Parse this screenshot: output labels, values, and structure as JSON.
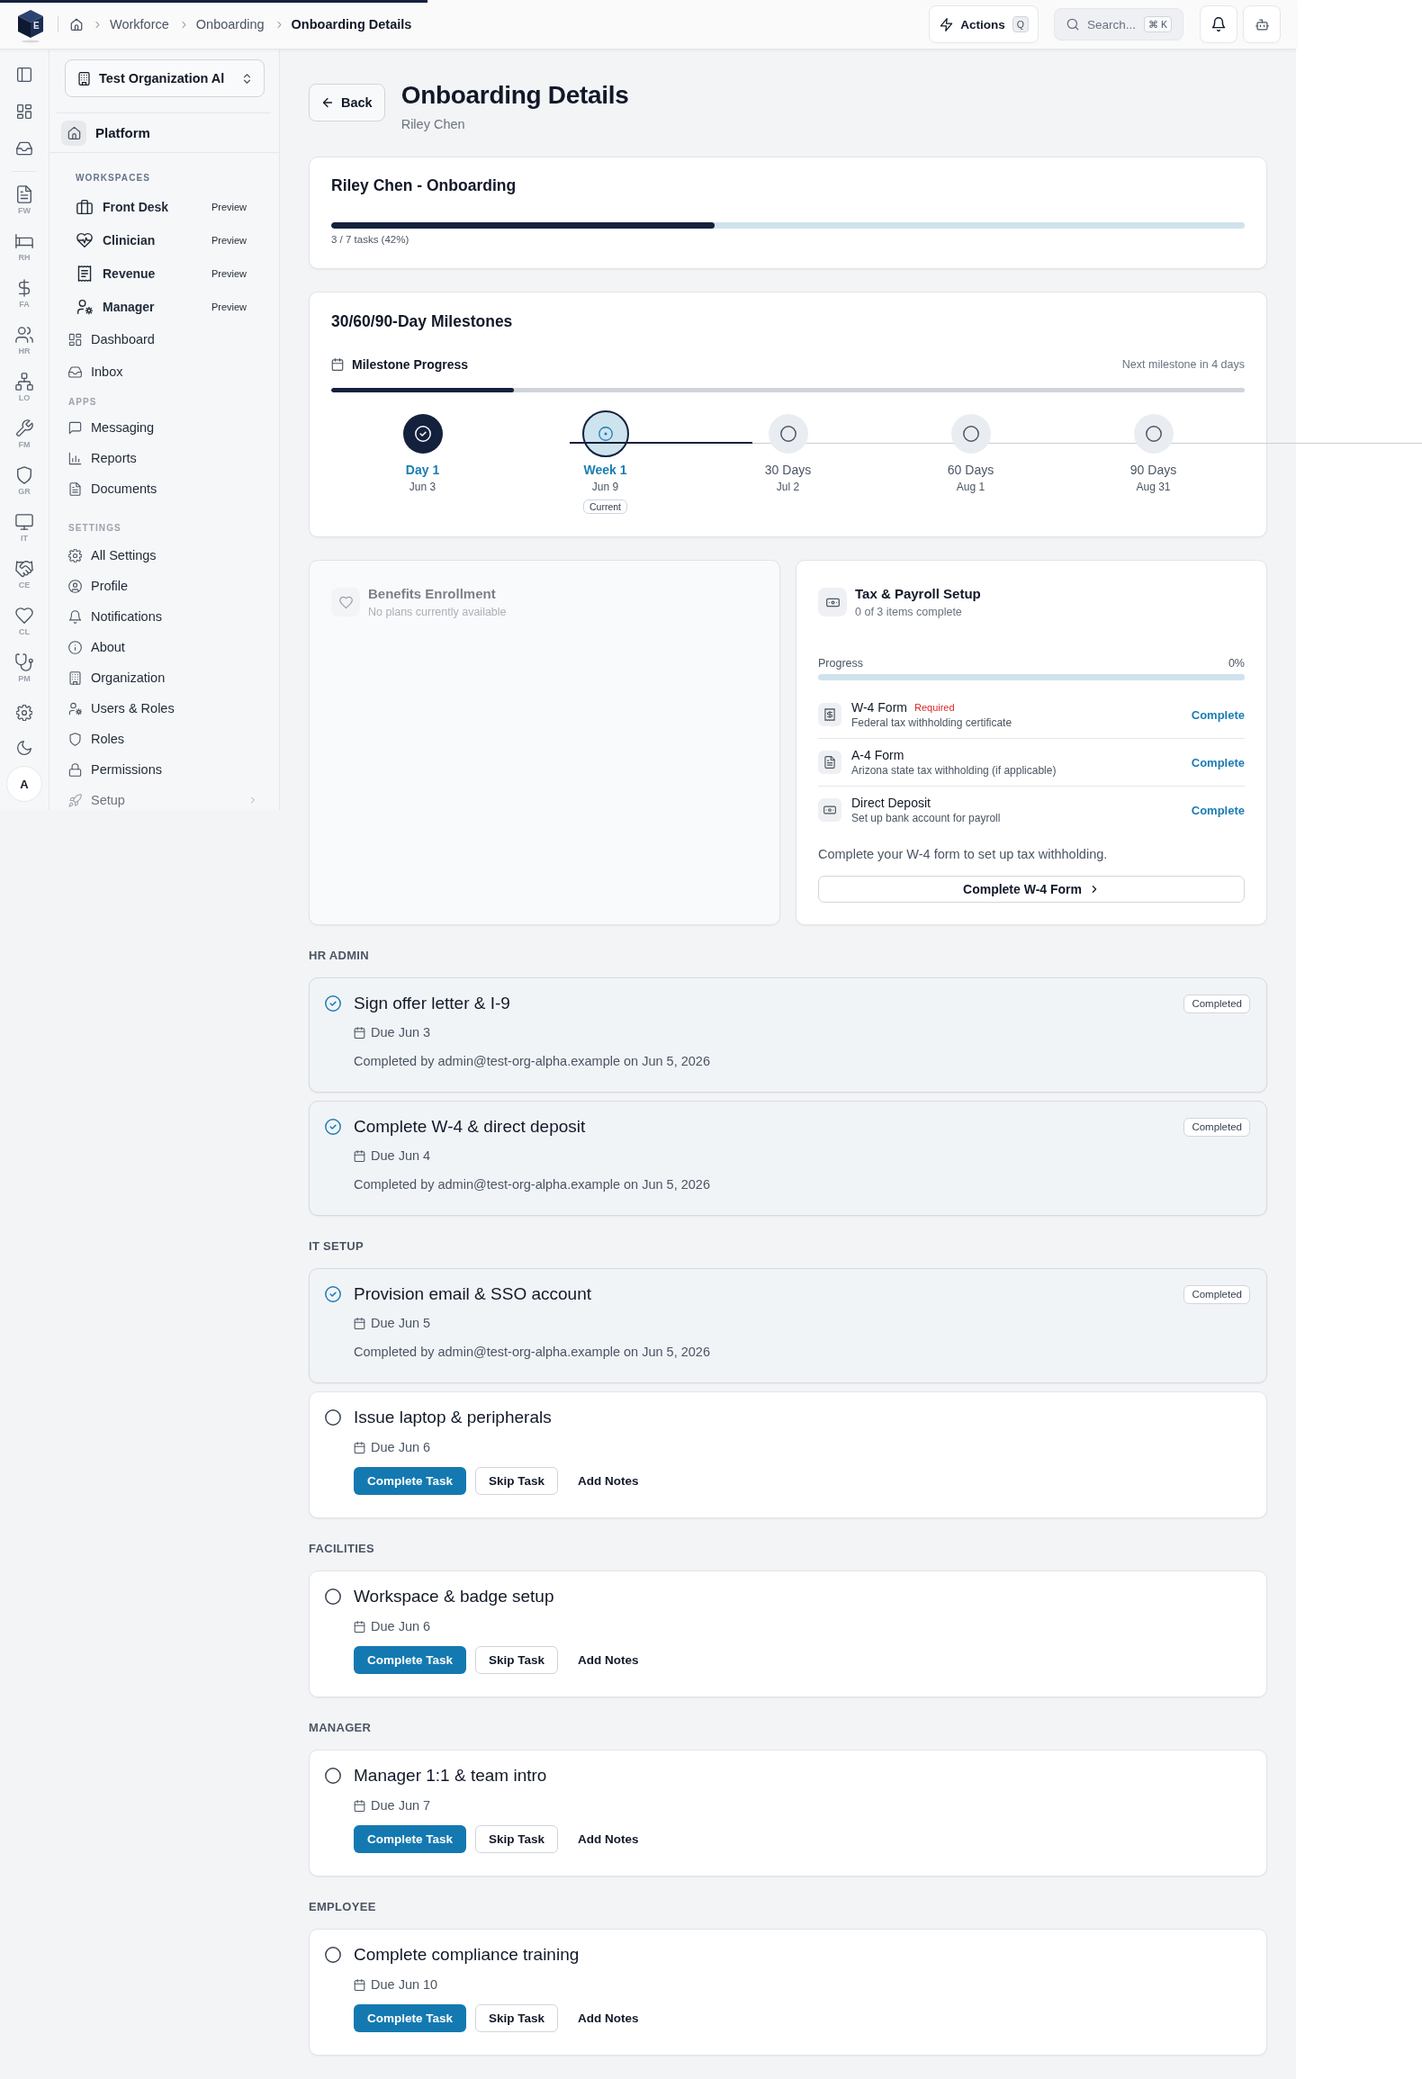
{
  "top_bar": {
    "loading_bar": {
      "level": 0.33
    },
    "logo": {
      "letter": "E"
    },
    "breadcrumbs": [
      {
        "label": "Workforce",
        "current": false
      },
      {
        "label": "Onboarding",
        "current": false
      },
      {
        "label": "Onboarding Details",
        "current": true
      }
    ],
    "actions_button": {
      "label": "Actions",
      "shortcut": "Q"
    },
    "search_button": {
      "label": "Search...",
      "shortcut": "⌘ K"
    }
  },
  "rail": {
    "items": [
      {
        "label": "FW"
      },
      {
        "label": "RH"
      },
      {
        "label": "FA"
      },
      {
        "label": "HR"
      },
      {
        "label": "LO"
      },
      {
        "label": "FM"
      },
      {
        "label": "GR"
      },
      {
        "label": "IT"
      },
      {
        "label": "CE"
      },
      {
        "label": "CL"
      },
      {
        "label": "PM"
      }
    ],
    "avatar": {
      "initial": "A"
    }
  },
  "sidebar": {
    "org_selector": {
      "value": "Test Organization Al"
    },
    "platform": {
      "label": "Platform"
    },
    "sections": [
      {
        "kind": "workspaces",
        "heading": "WORKSPACES",
        "items": [
          {
            "label": "Front Desk",
            "badge": "Preview"
          },
          {
            "label": "Clinician",
            "badge": "Preview"
          },
          {
            "label": "Revenue",
            "badge": "Preview"
          },
          {
            "label": "Manager",
            "badge": "Preview"
          }
        ]
      },
      {
        "kind": "nav",
        "items": [
          {
            "label": "Dashboard"
          },
          {
            "label": "Inbox"
          }
        ]
      },
      {
        "kind": "nav",
        "heading": "APPS",
        "items": [
          {
            "label": "Messaging"
          },
          {
            "label": "Reports"
          },
          {
            "label": "Documents"
          }
        ]
      },
      {
        "kind": "nav",
        "heading": "SETTINGS",
        "items": [
          {
            "label": "All Settings",
            "expandable": false
          },
          {
            "label": "Profile",
            "expandable": false
          },
          {
            "label": "Notifications",
            "expandable": false
          },
          {
            "label": "About",
            "expandable": false
          },
          {
            "label": "Organization",
            "expandable": false
          },
          {
            "label": "Users & Roles",
            "expandable": false
          },
          {
            "label": "Roles",
            "expandable": false
          },
          {
            "label": "Permissions",
            "expandable": false
          },
          {
            "label": "Setup",
            "expandable": true
          }
        ]
      }
    ]
  },
  "header": {
    "back_button": "Back",
    "title": "Onboarding Details",
    "subtitle": "Riley Chen"
  },
  "progress_card": {
    "title": "Riley Chen - Onboarding",
    "level": 0.42,
    "caption": "3 / 7 tasks (42%)"
  },
  "milestones_card": {
    "title": "30/60/90-Day Milestones",
    "progress_label": "Milestone Progress",
    "next_note": "Next milestone in 4 days",
    "level": 0.2,
    "milestones": [
      {
        "label": "Day 1",
        "date": "Jun 3",
        "completed": true,
        "current": false
      },
      {
        "label": "Week 1",
        "date": "Jun 9",
        "completed": false,
        "current": true,
        "badge": "Current"
      },
      {
        "label": "30 Days",
        "date": "Jul 2",
        "completed": false,
        "current": false
      },
      {
        "label": "60 Days",
        "date": "Aug 1",
        "completed": false,
        "current": false
      },
      {
        "label": "90 Days",
        "date": "Aug 31",
        "completed": false,
        "current": false
      }
    ]
  },
  "benefits_card": {
    "title": "Benefits Enrollment",
    "subtitle": "No plans currently available",
    "disabled": true
  },
  "tax_card": {
    "title": "Tax & Payroll Setup",
    "subtitle": "0 of 3 items complete",
    "progress_label": "Progress",
    "progress_value": "0%",
    "level": 0,
    "items": [
      {
        "title": "W-4 Form",
        "tag": "Required",
        "subtitle": "Federal tax withholding certificate",
        "action": "Complete"
      },
      {
        "title": "A-4 Form",
        "subtitle": "Arizona state tax withholding (if applicable)",
        "action": "Complete"
      },
      {
        "title": "Direct Deposit",
        "subtitle": "Set up bank account for payroll",
        "action": "Complete"
      }
    ],
    "hint": "Complete your W-4 form to set up tax withholding.",
    "button": "Complete W-4 Form"
  },
  "task_groups": [
    {
      "heading": "HR ADMIN",
      "tasks": [
        {
          "title": "Sign offer letter & I-9",
          "due": "Due Jun 3",
          "completed": true,
          "badge": "Completed",
          "note": "Completed by admin@test-org-alpha.example on Jun 5, 2026"
        },
        {
          "title": "Complete W-4 & direct deposit",
          "due": "Due Jun 4",
          "completed": true,
          "badge": "Completed",
          "note": "Completed by admin@test-org-alpha.example on Jun 5, 2026"
        }
      ]
    },
    {
      "heading": "IT SETUP",
      "tasks": [
        {
          "title": "Provision email & SSO account",
          "due": "Due Jun 5",
          "completed": true,
          "badge": "Completed",
          "note": "Completed by admin@test-org-alpha.example on Jun 5, 2026"
        },
        {
          "title": "Issue laptop & peripherals",
          "due": "Due Jun 6",
          "completed": false,
          "actions": [
            {
              "label": "Complete Task",
              "kind": "primary"
            },
            {
              "label": "Skip Task",
              "kind": "outline"
            },
            {
              "label": "Add Notes",
              "kind": "ghost"
            }
          ]
        }
      ]
    },
    {
      "heading": "FACILITIES",
      "tasks": [
        {
          "title": "Workspace & badge setup",
          "due": "Due Jun 6",
          "completed": false,
          "actions": [
            {
              "label": "Complete Task",
              "kind": "primary"
            },
            {
              "label": "Skip Task",
              "kind": "outline"
            },
            {
              "label": "Add Notes",
              "kind": "ghost"
            }
          ]
        }
      ]
    },
    {
      "heading": "MANAGER",
      "tasks": [
        {
          "title": "Manager 1:1 & team intro",
          "due": "Due Jun 7",
          "completed": false,
          "actions": [
            {
              "label": "Complete Task",
              "kind": "primary"
            },
            {
              "label": "Skip Task",
              "kind": "outline"
            },
            {
              "label": "Add Notes",
              "kind": "ghost"
            }
          ]
        }
      ]
    },
    {
      "heading": "EMPLOYEE",
      "tasks": [
        {
          "title": "Complete compliance training",
          "due": "Due Jun 10",
          "completed": false,
          "actions": [
            {
              "label": "Complete Task",
              "kind": "primary"
            },
            {
              "label": "Skip Task",
              "kind": "outline"
            },
            {
              "label": "Add Notes",
              "kind": "ghost"
            }
          ]
        }
      ]
    }
  ]
}
